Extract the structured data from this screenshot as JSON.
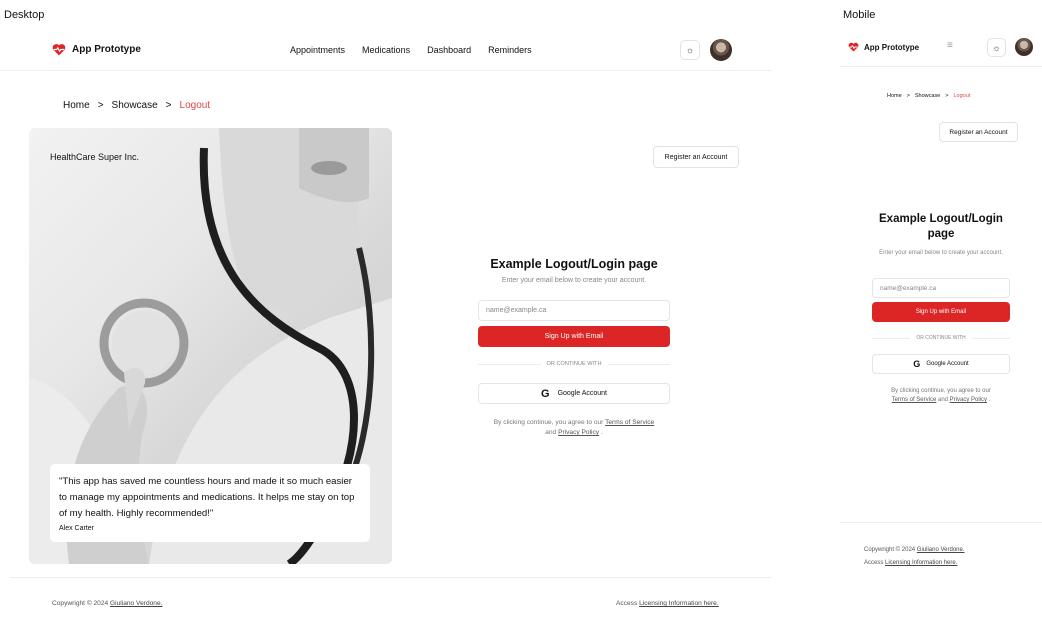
{
  "labels": {
    "desktop": "Desktop",
    "mobile": "Mobile"
  },
  "app": {
    "name": "App Prototype"
  },
  "nav": {
    "links": [
      "Appointments",
      "Medications",
      "Dashboard",
      "Reminders"
    ]
  },
  "breadcrumb": {
    "home": "Home",
    "showcase": "Showcase",
    "current": "Logout",
    "sep": ">"
  },
  "hero": {
    "company": "HealthCare Super Inc.",
    "quote": "\"This app has saved me countless hours and made it so much easier to manage my appointments and medications. It helps me stay on top of my health. Highly recommended!\"",
    "author": "Alex Carter"
  },
  "form": {
    "register": "Register an Account",
    "title": "Example Logout/Login page",
    "mobile_title": "Example Logout/Login page",
    "subtitle": "Enter your email below to create your account.",
    "email_placeholder": "name@example.ca",
    "signup": "Sign Up with Email",
    "divider": "OR CONTINUE WITH",
    "google": "Google Account",
    "legal_pre": "By clicking continue, you agree to our",
    "terms": "Terms of Service",
    "and": "and",
    "privacy": "Privacy Policy",
    "end": "."
  },
  "footer": {
    "copyright": "Copywright © 2024",
    "author": "Giuliano Verdone.",
    "access": "Access",
    "license": "Licensing Information here."
  },
  "colors": {
    "accent": "#dc2626",
    "breadcrumb_current": "#e04646"
  }
}
